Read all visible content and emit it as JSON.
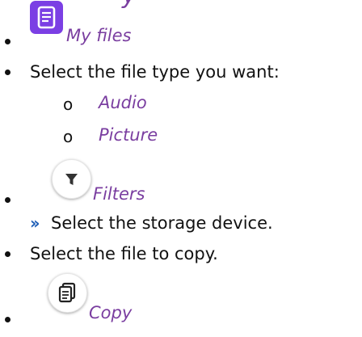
{
  "top_fragment": "y",
  "steps": [
    {
      "label": "My files"
    },
    {
      "label": "Select the file type you want:"
    },
    {
      "label": "Filters"
    },
    {
      "label": "Select the storage device."
    },
    {
      "label": "Select the file to copy."
    },
    {
      "label": "Copy"
    }
  ],
  "file_types": [
    {
      "marker": "o",
      "label": "Audio"
    },
    {
      "marker": "o",
      "label": "Picture"
    }
  ],
  "substep_marker": "››",
  "icons": {
    "my_files": "document-icon",
    "filters": "filter-icon",
    "copy": "copy-icon"
  },
  "colors": {
    "italic_text": "#7a3ea0",
    "icon_purple": "#7b3fe4",
    "substep_marker": "#1f5fb7"
  }
}
